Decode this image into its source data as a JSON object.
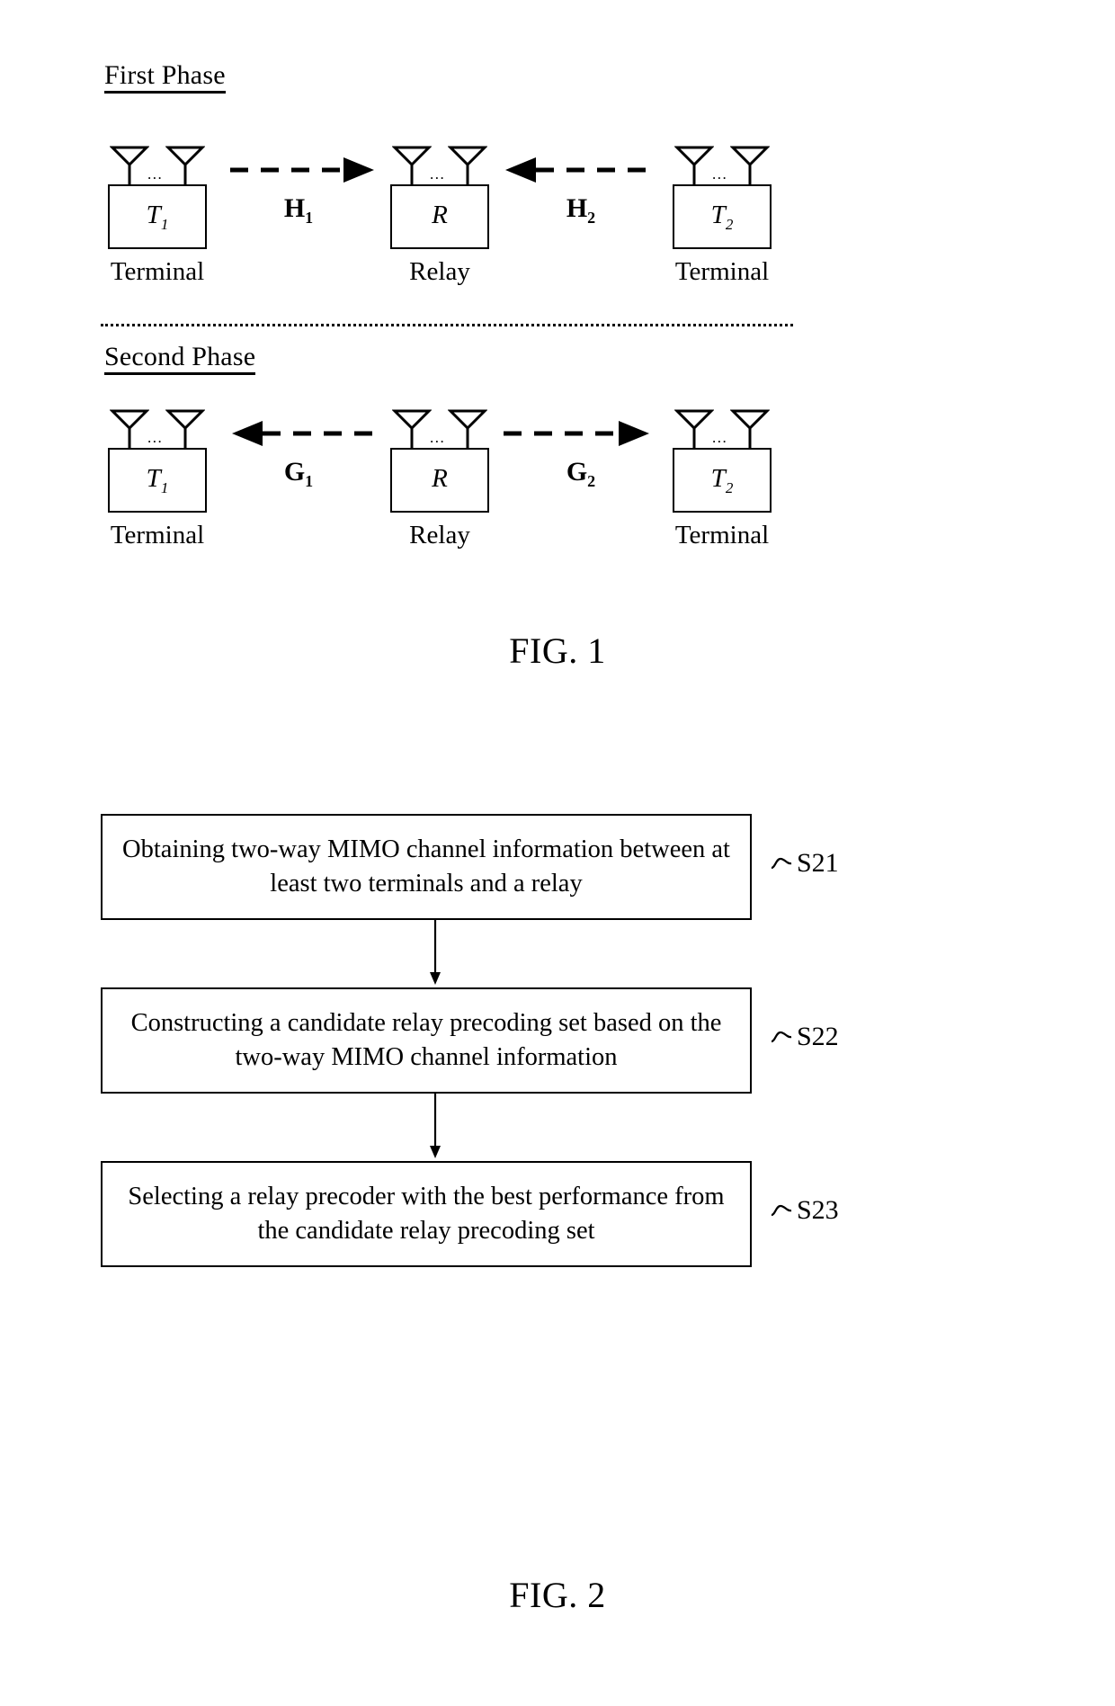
{
  "figure1": {
    "caption": "FIG. 1",
    "phases": [
      {
        "heading": "First Phase",
        "nodes": [
          {
            "box_label": "T",
            "box_sub": "1",
            "caption": "Terminal",
            "antenna_dots": "..."
          },
          {
            "box_label": "R",
            "box_sub": "",
            "caption": "Relay",
            "antenna_dots": "..."
          },
          {
            "box_label": "T",
            "box_sub": "2",
            "caption": "Terminal",
            "antenna_dots": "..."
          }
        ],
        "channels": [
          {
            "label": "H",
            "sub": "1",
            "direction": "right"
          },
          {
            "label": "H",
            "sub": "2",
            "direction": "left"
          }
        ]
      },
      {
        "heading": "Second Phase",
        "nodes": [
          {
            "box_label": "T",
            "box_sub": "1",
            "caption": "Terminal",
            "antenna_dots": "..."
          },
          {
            "box_label": "R",
            "box_sub": "",
            "caption": "Relay",
            "antenna_dots": "..."
          },
          {
            "box_label": "T",
            "box_sub": "2",
            "caption": "Terminal",
            "antenna_dots": "..."
          }
        ],
        "channels": [
          {
            "label": "G",
            "sub": "1",
            "direction": "left"
          },
          {
            "label": "G",
            "sub": "2",
            "direction": "right"
          }
        ]
      }
    ]
  },
  "figure2": {
    "caption": "FIG. 2",
    "steps": [
      {
        "text": "Obtaining two-way MIMO channel information between at least two terminals and a relay",
        "tag": "S21"
      },
      {
        "text": "Constructing a candidate relay precoding set based on the two-way MIMO channel information",
        "tag": "S22"
      },
      {
        "text": "Selecting a relay precoder with the best performance from the candidate relay precoding set",
        "tag": "S23"
      }
    ]
  },
  "colors": {
    "ink": "#000000",
    "paper": "#ffffff"
  }
}
